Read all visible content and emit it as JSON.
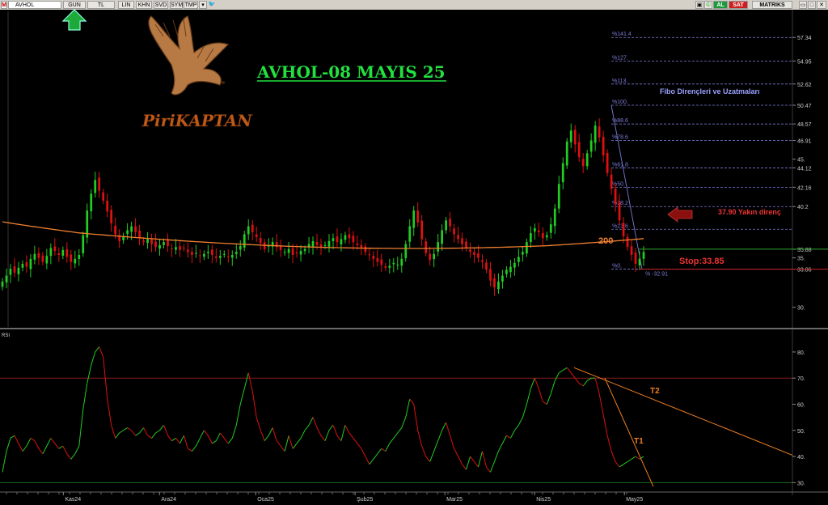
{
  "toolbar": {
    "menu_label": "M",
    "symbol": "AVHOL",
    "period": "GUN",
    "currency": "TL",
    "buttons": [
      "LIN",
      "KHN",
      "SVD",
      "SYM",
      "TMP"
    ],
    "buy": "AL",
    "sell": "SAT",
    "brand": "MATRIKS"
  },
  "colors": {
    "up": "#22cc22",
    "down": "#dd1111",
    "ma": "#f08030",
    "fib": "#7b7bd6",
    "title": "#22e040",
    "annotation": "#ee3333",
    "trend": "#f08020"
  },
  "header": {
    "title": "AVHOL-08 MAYIS 25",
    "logo_text": "PiriKAPTAN"
  },
  "annotations": {
    "fibo_title": "Fibo Dirençleri ve Uzatmaları",
    "resistance": "37.90 Yakın direnç",
    "stop": "Stop:33.85",
    "ma_label": "200",
    "rsi_title": "RSI",
    "t1": "T1",
    "t2": "T2"
  },
  "chart_data": [
    {
      "type": "candlestick",
      "title": "AVHOL-08 MAYIS 25",
      "ylim": [
        28,
        59
      ],
      "y_ticks": [
        {
          "v": 57.34,
          "label": "57.34"
        },
        {
          "v": 54.95,
          "label": "54.95"
        },
        {
          "v": 52.62,
          "label": "52.62"
        },
        {
          "v": 50.47,
          "label": "50.47"
        },
        {
          "v": 48.57,
          "label": "48.57"
        },
        {
          "v": 46.91,
          "label": "46.91"
        },
        {
          "v": 45.0,
          "label": "45."
        },
        {
          "v": 44.12,
          "label": "44.12"
        },
        {
          "v": 42.16,
          "label": "42.16"
        },
        {
          "v": 40.2,
          "label": "40.2"
        },
        {
          "v": 35.88,
          "label": "35.88"
        },
        {
          "v": 35.0,
          "label": "35."
        },
        {
          "v": 33.86,
          "label": "33.86"
        },
        {
          "v": 30.0,
          "label": "30."
        }
      ],
      "x_labels": [
        "Kas24",
        "Ara24",
        "Oca25",
        "Şub25",
        "Mar25",
        "Nis25",
        "May25"
      ],
      "fib_levels": [
        {
          "label": "%141.4",
          "value": 57.34
        },
        {
          "label": "%127.",
          "value": 54.95
        },
        {
          "label": "%113.",
          "value": 52.62
        },
        {
          "label": "%100.",
          "value": 50.47
        },
        {
          "label": "%88.6",
          "value": 48.57
        },
        {
          "label": "%78.6",
          "value": 46.91
        },
        {
          "label": "%61.8",
          "value": 44.12
        },
        {
          "label": "%50.",
          "value": 42.16
        },
        {
          "label": "%38.2",
          "value": 40.2
        },
        {
          "label": "%23.6",
          "value": 37.9
        },
        {
          "label": "%0.",
          "value": 33.86
        },
        {
          "label": "% -32.91",
          "value": 33.86
        }
      ],
      "ma200_value": 35.88,
      "stop": 33.85,
      "resistance": 37.9,
      "closes": [
        32.6,
        33.2,
        33.9,
        33.5,
        34.0,
        34.4,
        34.1,
        34.9,
        35.4,
        35.0,
        34.6,
        35.2,
        36.0,
        35.7,
        35.3,
        35.8,
        35.1,
        34.6,
        34.9,
        35.3,
        37.3,
        39.8,
        41.5,
        42.9,
        41.8,
        40.8,
        39.7,
        38.5,
        37.4,
        36.7,
        37.2,
        37.8,
        38.2,
        37.6,
        37.0,
        36.6,
        36.9,
        36.4,
        36.1,
        36.3,
        36.6,
        36.2,
        35.9,
        36.1,
        35.8,
        36.0,
        35.6,
        35.3,
        35.5,
        35.2,
        35.4,
        35.6,
        35.3,
        35.0,
        35.2,
        35.4,
        35.1,
        35.3,
        35.6,
        36.2,
        37.4,
        38.2,
        37.6,
        37.1,
        36.5,
        35.9,
        36.3,
        36.6,
        36.1,
        35.8,
        35.6,
        35.9,
        35.3,
        35.5,
        35.7,
        35.9,
        36.4,
        36.7,
        36.3,
        36.0,
        36.3,
        36.7,
        37.0,
        36.6,
        36.9,
        37.3,
        37.0,
        36.6,
        36.3,
        36.0,
        35.6,
        35.3,
        34.9,
        34.6,
        34.3,
        34.0,
        34.2,
        34.5,
        34.3,
        34.9,
        36.4,
        38.2,
        39.8,
        38.6,
        36.9,
        35.5,
        34.8,
        35.4,
        36.6,
        37.8,
        38.8,
        38.2,
        37.4,
        36.9,
        36.4,
        36.0,
        35.6,
        35.3,
        35.0,
        34.6,
        33.8,
        32.7,
        32.0,
        32.6,
        33.2,
        33.8,
        34.1,
        34.5,
        35.1,
        35.6,
        36.6,
        37.5,
        38.0,
        37.6,
        37.0,
        37.3,
        38.4,
        40.0,
        42.5,
        44.6,
        46.8,
        47.9,
        46.5,
        45.2,
        44.3,
        45.6,
        46.9,
        48.4,
        47.2,
        45.4,
        43.6,
        42.0,
        40.5,
        38.8,
        37.2,
        36.1,
        35.3,
        34.4,
        34.9,
        35.6
      ]
    },
    {
      "type": "line",
      "title": "RSI",
      "ylim": [
        27,
        84
      ],
      "y_ticks": [
        80,
        70,
        60,
        50,
        40,
        30
      ],
      "reference_lines": [
        70,
        30
      ],
      "values": [
        34,
        42,
        47,
        48,
        45,
        42,
        44,
        47,
        46,
        43,
        41,
        44,
        47,
        45,
        43,
        44,
        41,
        39,
        41,
        44,
        58,
        68,
        75,
        80,
        82,
        78,
        62,
        52,
        47,
        49,
        50,
        51,
        50,
        48,
        49,
        51,
        48,
        47,
        49,
        50,
        52,
        48,
        46,
        47,
        45,
        48,
        43,
        42,
        44,
        47,
        50,
        48,
        45,
        46,
        49,
        47,
        45,
        47,
        52,
        60,
        66,
        72,
        65,
        55,
        50,
        46,
        48,
        51,
        46,
        44,
        42,
        48,
        43,
        45,
        47,
        50,
        52,
        55,
        51,
        48,
        46,
        50,
        52,
        48,
        46,
        52,
        49,
        47,
        45,
        43,
        40,
        37,
        39,
        41,
        43,
        42,
        45,
        47,
        49,
        51,
        55,
        62,
        60,
        50,
        44,
        40,
        38,
        42,
        46,
        50,
        53,
        48,
        43,
        40,
        37,
        35,
        40,
        38,
        36,
        42,
        36,
        34,
        38,
        42,
        45,
        48,
        47,
        50,
        52,
        55,
        60,
        66,
        70,
        66,
        61,
        60,
        64,
        69,
        72,
        73,
        74,
        72,
        70,
        68,
        67,
        69,
        70,
        70,
        64,
        56,
        48,
        42,
        38,
        36,
        37,
        38,
        39,
        40,
        39,
        40
      ]
    }
  ]
}
